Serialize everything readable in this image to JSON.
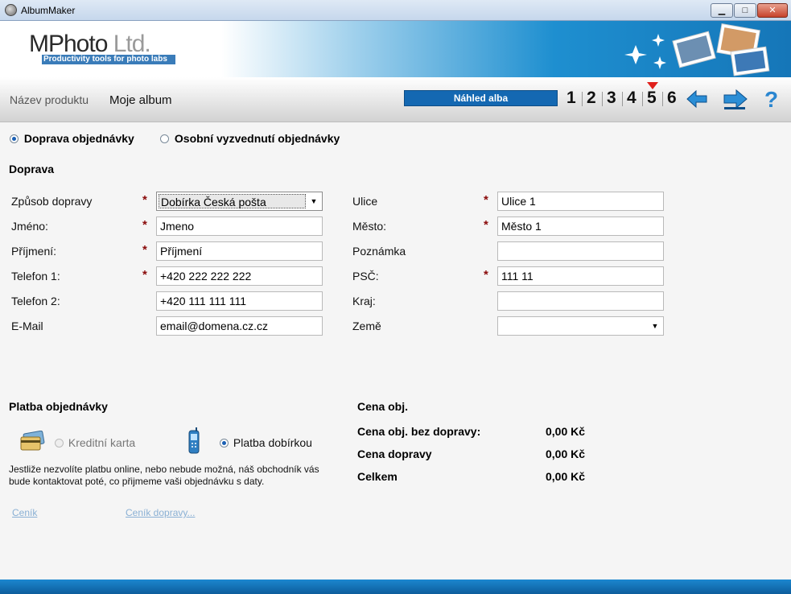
{
  "window": {
    "title": "AlbumMaker",
    "minimize": "▁",
    "maximize": "□",
    "close": "✕"
  },
  "banner": {
    "logo_main": "MPhoto",
    "logo_ltd": " Ltd.",
    "tagline": "Productivity tools for photo labs"
  },
  "toolbar": {
    "product_label": "Název produktu",
    "product_value": "Moje album",
    "preview_button": "Náhled alba",
    "steps": [
      "1",
      "2",
      "3",
      "4",
      "5",
      "6"
    ],
    "active_step": "5",
    "help": "?"
  },
  "delivery_mode": {
    "options": [
      "Doprava objednávky",
      "Osobní vyzvednutí objednávky"
    ],
    "selected": "Doprava objednávky"
  },
  "shipping": {
    "heading": "Doprava",
    "left": [
      {
        "label": "Způsob dopravy",
        "required": "*",
        "value": "Dobírka Česká pošta",
        "type": "select"
      },
      {
        "label": "Jméno:",
        "required": "*",
        "value": "Jmeno"
      },
      {
        "label": "Příjmení:",
        "required": "*",
        "value": "Příjmení"
      },
      {
        "label": "Telefon 1:",
        "required": "*",
        "value": "+420 222 222 222"
      },
      {
        "label": "Telefon 2:",
        "required": "",
        "value": "+420 111 111 111"
      },
      {
        "label": "E-Mail",
        "required": "",
        "value": "email@domena.cz.cz"
      }
    ],
    "right": [
      {
        "label": "Ulice",
        "required": "*",
        "value": "Ulice 1"
      },
      {
        "label": "Město:",
        "required": "*",
        "value": "Město 1"
      },
      {
        "label": "Poznámka",
        "required": "",
        "value": ""
      },
      {
        "label": "PSČ:",
        "required": "*",
        "value": "111 11"
      },
      {
        "label": "Kraj:",
        "required": "",
        "value": ""
      },
      {
        "label": "Země",
        "required": "",
        "value": "",
        "type": "select"
      }
    ]
  },
  "payment": {
    "heading": "Platba objednávky",
    "options": [
      "Kreditní karta",
      "Platba dobírkou"
    ],
    "selected": "Platba dobírkou",
    "note_line1": "Jestliže nezvolíte platbu online, nebo nebude možná, náš obchodník vás",
    "note_line2": "bude kontaktovat poté, co přijmeme vaši objednávku s daty."
  },
  "price": {
    "heading": "Cena obj.",
    "rows": [
      {
        "label": "Cena obj. bez dopravy:",
        "value": "0,00 Kč"
      },
      {
        "label": "Cena dopravy",
        "value": "0,00 Kč"
      },
      {
        "label": "Celkem",
        "value": "0,00 Kč"
      }
    ]
  },
  "links": {
    "price_list": "Ceník",
    "shipping_price_list": "Ceník dopravy..."
  },
  "colors": {
    "accent": "#1468b2",
    "required": "#8a0a0a",
    "marker": "#e0201c",
    "link": "#8ab0d4"
  }
}
